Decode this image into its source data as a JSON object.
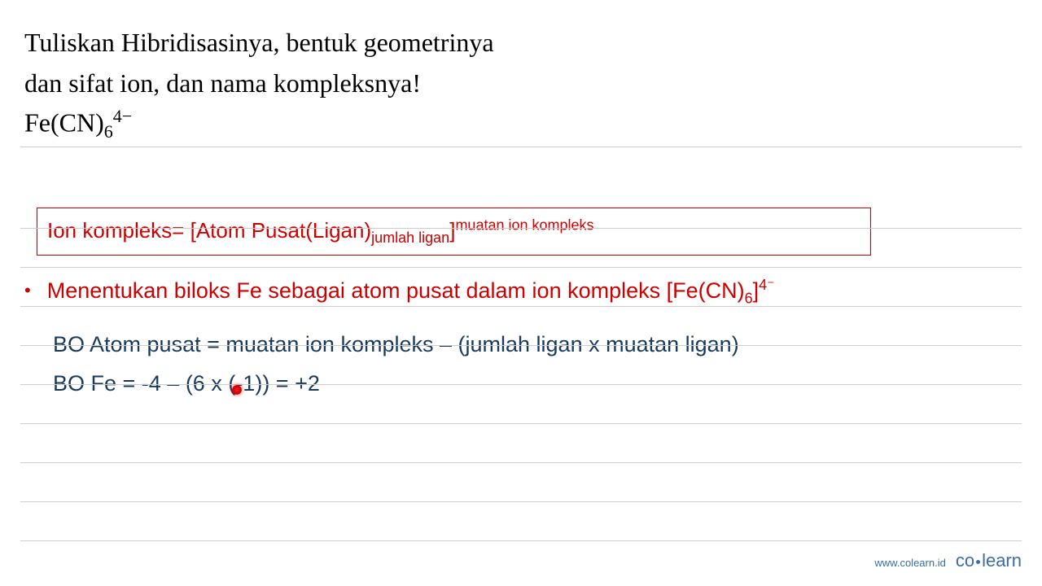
{
  "question": {
    "line1": "Tuliskan Hibridisasinya, bentuk geometrinya",
    "line2": "dan sifat ion, dan nama kompleksnya!",
    "formula_base": "Fe(CN)",
    "formula_sub": "6",
    "formula_sup": "4−"
  },
  "redbox": {
    "prefix": "Ion kompleks= [Atom Pusat(Ligan)",
    "sub": "jumlah ligan",
    "mid": "]",
    "sup": "muatan ion kompleks"
  },
  "bullet": {
    "marker": "•",
    "text_prefix": "Menentukan biloks Fe sebagai atom pusat dalam ion kompleks [Fe(CN)",
    "sub": "6",
    "mid": "]",
    "sup": "4⁻"
  },
  "line1": "BO Atom pusat = muatan ion kompleks – (jumlah ligan x muatan ligan)",
  "line2": "BO Fe = -4 – (6 x (-1)) = +2",
  "footer": {
    "url": "www.colearn.id",
    "logo_pre": "co",
    "logo_post": "learn"
  }
}
